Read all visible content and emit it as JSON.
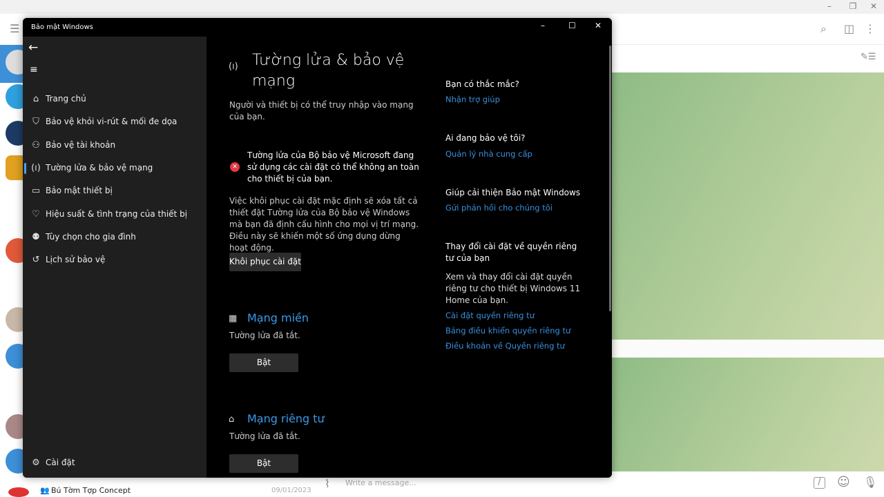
{
  "telegram": {
    "chat_preview": {
      "name": "Bú Tờm Tợp Concept",
      "date": "09/01/2023"
    },
    "input_placeholder": "Write a message..."
  },
  "defender": {
    "window_title": "Bảo mật Windows",
    "nav": [
      {
        "label": "Trang chủ",
        "icon": "home-icon"
      },
      {
        "label": "Bảo vệ khỏi vi-rút & mối đe dọa",
        "icon": "shield-icon"
      },
      {
        "label": "Bảo vệ tài khoản",
        "icon": "person-icon"
      },
      {
        "label": "Tường lửa & bảo vệ mạng",
        "icon": "wifi-antenna-icon",
        "selected": true
      },
      {
        "label": "Bảo mật thiết bị",
        "icon": "laptop-icon"
      },
      {
        "label": "Hiệu suất & tình trạng của thiết bị",
        "icon": "heart-icon"
      },
      {
        "label": "Tùy chọn cho gia đình",
        "icon": "family-icon"
      },
      {
        "label": "Lịch sử bảo vệ",
        "icon": "history-icon"
      }
    ],
    "settings_label": "Cài đặt",
    "page_title": "Tường lửa & bảo vệ mạng",
    "page_subtitle": "Người và thiết bị có thể truy nhập vào mạng của bạn.",
    "warning": "Tường lửa của Bộ bảo vệ Microsoft đang sử dụng các cài đặt có thể không an toàn cho thiết bị của bạn.",
    "restore_desc": "Việc khôi phục cài đặt mặc định sẽ xóa tất cả thiết đặt Tường lửa của Bộ bảo vệ Windows mà bạn đã định cấu hình cho mọi vị trí mạng. Điều này sẽ khiến một số ứng dụng dừng hoạt động.",
    "restore_button": "Khôi phục cài đặt",
    "networks": [
      {
        "title": "Mạng miền",
        "status": "Tường lửa đã tắt.",
        "button": "Bật"
      },
      {
        "title": "Mạng riêng tư",
        "status": "Tường lửa đã tắt.",
        "button": "Bật"
      }
    ],
    "side": {
      "q1": "Bạn có thắc mắc?",
      "l1": "Nhận trợ giúp",
      "q2": "Ai đang bảo vệ tôi?",
      "l2": "Quản lý nhà cung cấp",
      "q3": "Giúp cải thiện Bảo mật Windows",
      "l3": "Gửi phản hồi cho chúng tôi",
      "q4": "Thay đổi cài đặt về quyền riêng tư của bạn",
      "d4": "Xem và thay đổi cài đặt quyền riêng tư cho thiết bị Windows 11 Home của bạn.",
      "links4": [
        "Cài đặt quyền riêng tư",
        "Bảng điều khiển quyền riêng tư",
        "Điều khoản về Quyền riêng tư"
      ]
    }
  }
}
